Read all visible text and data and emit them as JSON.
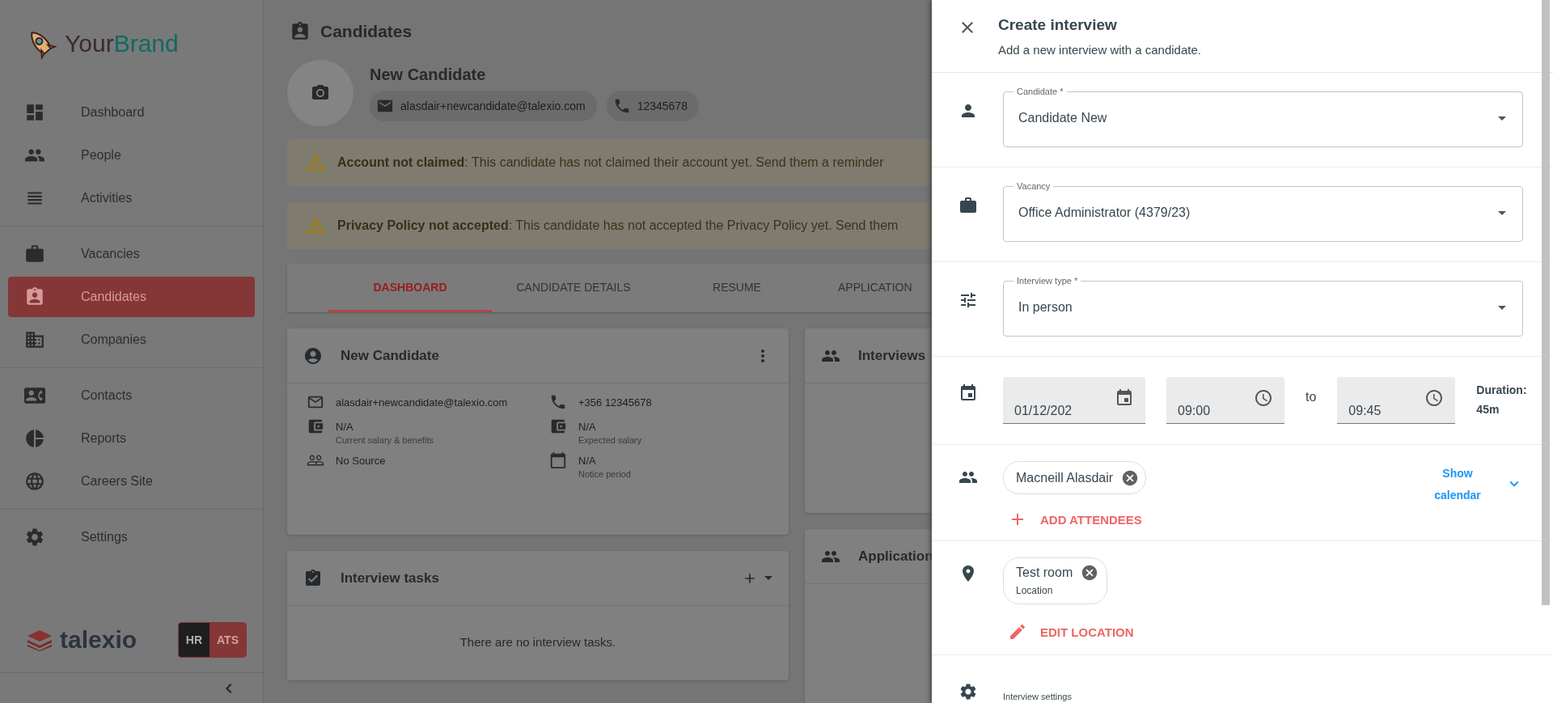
{
  "brand": {
    "first": "Your",
    "second": "Brand"
  },
  "sidebar": {
    "groups": [
      [
        {
          "label": "Dashboard",
          "selected": false
        },
        {
          "label": "People",
          "selected": false
        },
        {
          "label": "Activities",
          "selected": false
        }
      ],
      [
        {
          "label": "Vacancies",
          "selected": false
        },
        {
          "label": "Candidates",
          "selected": true
        },
        {
          "label": "Companies",
          "selected": false
        }
      ],
      [
        {
          "label": "Contacts",
          "selected": false
        },
        {
          "label": "Reports",
          "selected": false
        },
        {
          "label": "Careers Site",
          "selected": false
        }
      ],
      [
        {
          "label": "Settings",
          "selected": false
        }
      ]
    ],
    "footer_logo": "talexio",
    "modes": [
      {
        "label": "HR",
        "selected": false
      },
      {
        "label": "ATS",
        "selected": true
      }
    ]
  },
  "page": {
    "title": "Candidates",
    "profile": {
      "name": "New Candidate",
      "email": "alasdair+newcandidate@talexio.com",
      "phone": "12345678"
    },
    "alerts": [
      "**Account not claimed**: This candidate has not claimed their account yet. Send them a reminder",
      "**Privacy Policy not accepted**: This candidate has not accepted the Privacy Policy yet. Send them"
    ],
    "tabs": [
      {
        "label": "DASHBOARD",
        "selected": true
      },
      {
        "label": "CANDIDATE DETAILS",
        "selected": false
      },
      {
        "label": "RESUME",
        "selected": false
      },
      {
        "label": "APPLICATION",
        "selected": false
      }
    ],
    "details_card": {
      "title": "New Candidate",
      "columns": [
        [
          {
            "value": "alasdair+newcandidate@talexio.com"
          },
          {
            "value": "N/A",
            "caption": "Current salary & benefits"
          },
          {
            "value": "No Source"
          }
        ],
        [
          {
            "value": "+356 12345678"
          },
          {
            "value": "N/A",
            "caption": "Expected salary"
          },
          {
            "value": "N/A",
            "caption": "Notice period"
          }
        ]
      ]
    },
    "tasks_card": {
      "title": "Interview tasks",
      "empty": "There are no interview tasks."
    },
    "side_cards": [
      {
        "title": "Interviews"
      },
      {
        "title": "Application"
      }
    ]
  },
  "drawer": {
    "title": "Create interview",
    "subtitle": "Add a new interview with a candidate.",
    "selects": [
      {
        "label": "Candidate *",
        "value": "Candidate New"
      },
      {
        "label": "Vacancy",
        "value": "Office Administrator (4379/23)"
      },
      {
        "label": "Interview type *",
        "value": "In person"
      }
    ],
    "schedule": {
      "date": "01/12/202",
      "start": "09:00",
      "separator": "to",
      "end": "09:45",
      "duration_label": "Duration:",
      "duration": "45m"
    },
    "attendees": [
      {
        "name": "Macneill Alasdair"
      }
    ],
    "show_calendar": "Show calendar",
    "add_attendees": "ADD ATTENDEES",
    "location": {
      "name": "Test room",
      "caption": "Location"
    },
    "edit_location": "EDIT LOCATION",
    "settings_label": "Interview settings"
  }
}
